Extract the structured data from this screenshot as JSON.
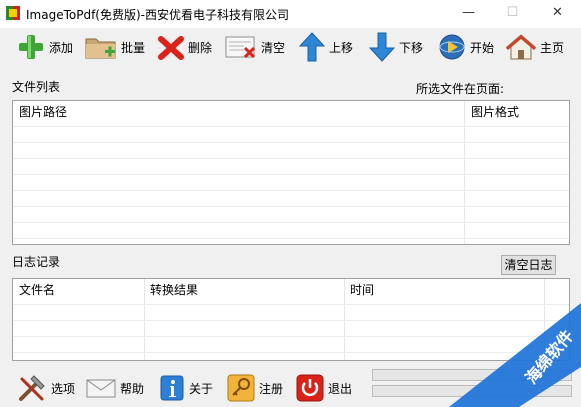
{
  "window": {
    "title": "ImageToPdf(免费版)-西安优看电子科技有限公司",
    "controls": {
      "minimize": "—",
      "maximize": "☐",
      "close": "✕"
    }
  },
  "toolbar": {
    "add": "添加",
    "batch": "批量",
    "delete": "删除",
    "clear": "清空",
    "move_up": "上移",
    "move_down": "下移",
    "start": "开始",
    "home": "主页"
  },
  "file_list": {
    "label": "文件列表",
    "selected_page_label": "所选文件在页面:",
    "columns": [
      "图片路径",
      "图片格式"
    ]
  },
  "log": {
    "label": "日志记录",
    "clear_button": "清空日志",
    "columns": [
      "文件名",
      "转换结果",
      "时间"
    ]
  },
  "bottom": {
    "options": "选项",
    "help": "帮助",
    "about": "关于",
    "register": "注册",
    "exit": "退出"
  },
  "watermark": {
    "text": "海绵软件"
  },
  "colors": {
    "accent_green": "#3fa53a",
    "accent_red": "#d9231a",
    "accent_blue": "#2e86d6",
    "watermark_blue": "#1e73d8"
  }
}
